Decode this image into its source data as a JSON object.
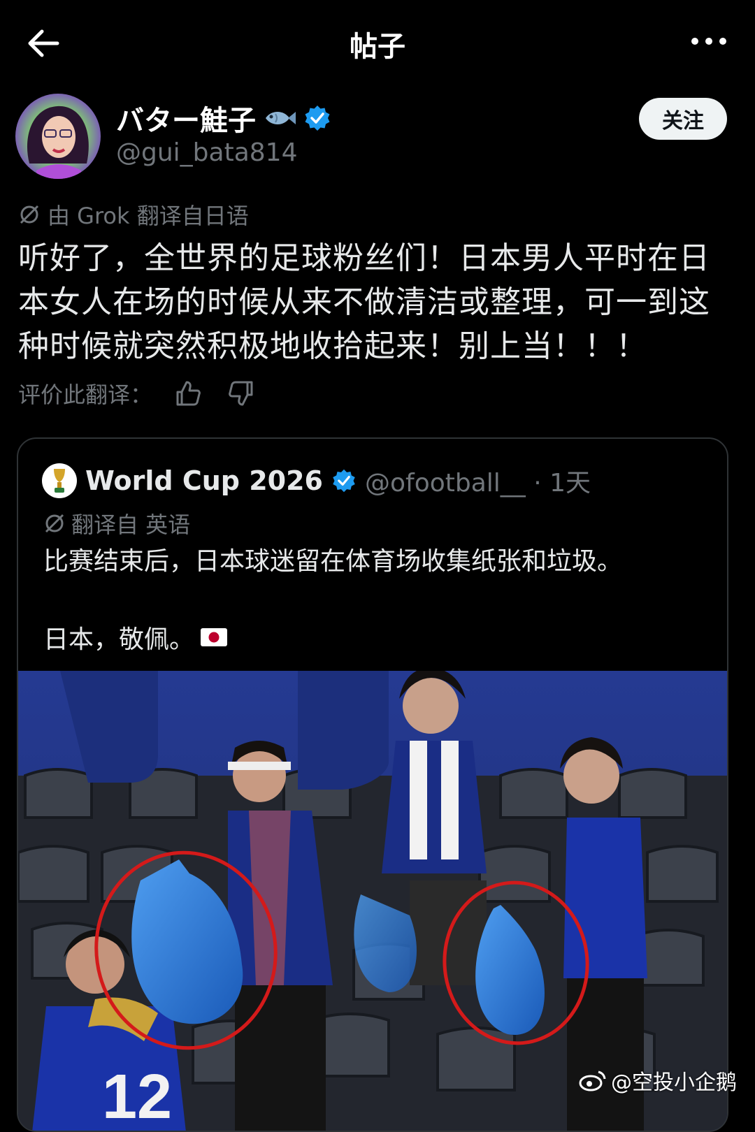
{
  "header": {
    "title": "帖子"
  },
  "author": {
    "display_name": "バター鮭子",
    "handle": "@gui_bata814",
    "follow_label": "关注"
  },
  "post": {
    "translated_note": "由 Grok 翻译自日语",
    "lines": [
      "听好了，全世界的足球粉丝们！日本男人平时在日",
      "本女人在场的时候从来不做清洁或整理，可一到这",
      "种时候就突然积极地收拾起来！别上当！！！"
    ],
    "rate_label": "评价此翻译："
  },
  "quote": {
    "name": "World Cup 2026",
    "handle_time": "@ofootball__ · 1天",
    "translated_note": "翻译自 英语",
    "text": "比赛结束后，日本球迷留在体育场收集纸张和垃圾。",
    "text2": "日本，敬佩。"
  },
  "watermark": "@空投小企鹅",
  "colors": {
    "verified": "#1d9bf0",
    "background": "#000000",
    "muted": "#71767b",
    "circle": "#d41a1a"
  }
}
